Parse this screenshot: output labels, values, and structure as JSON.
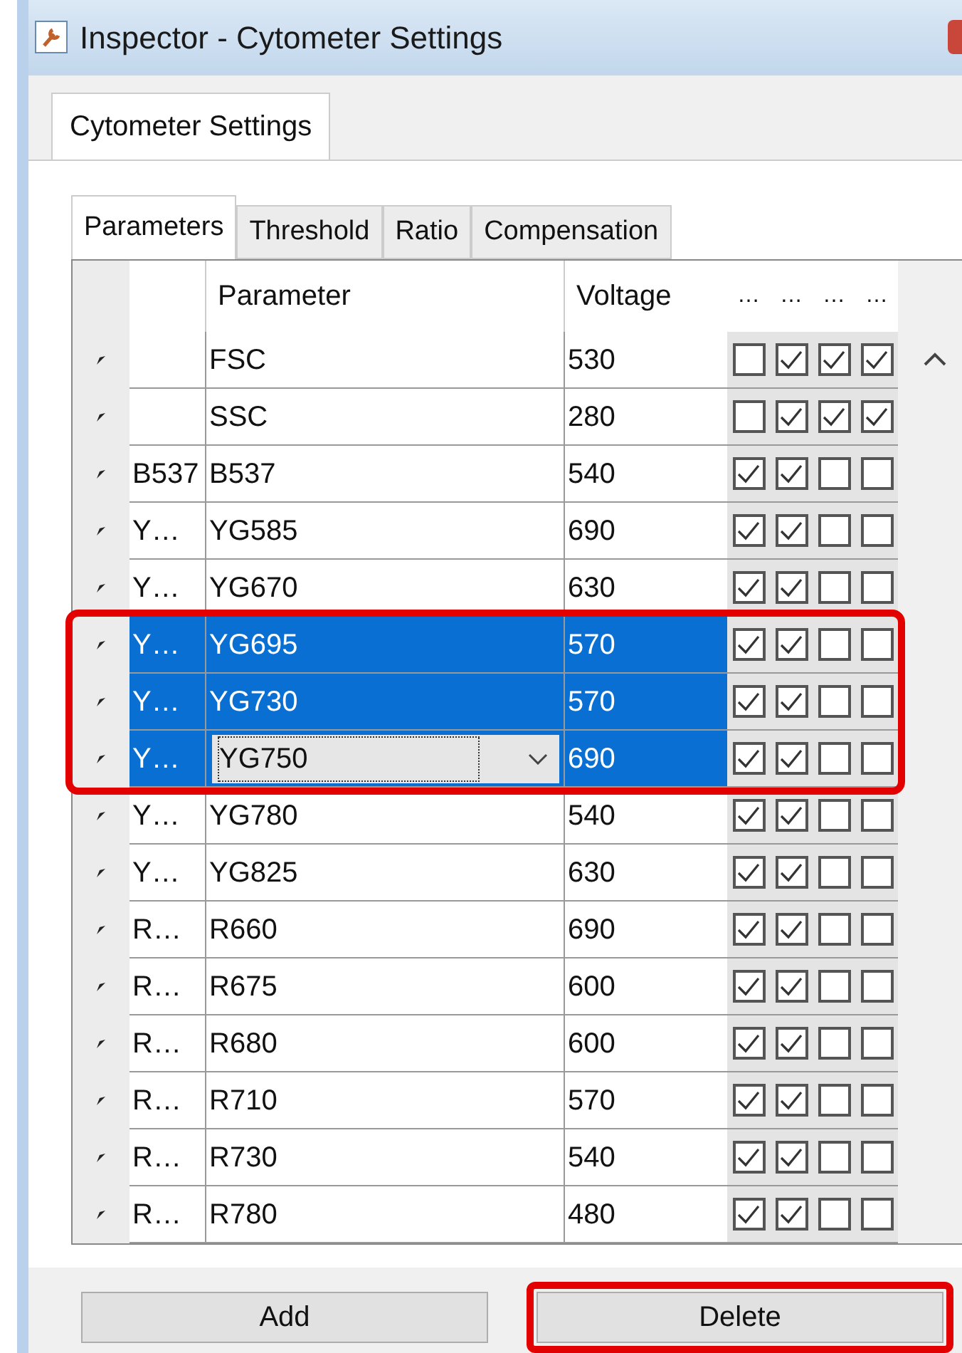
{
  "window": {
    "title": "Inspector - Cytometer Settings"
  },
  "outer_tabs": [
    {
      "label": "Cytometer Settings",
      "selected": true
    }
  ],
  "tabs": [
    {
      "label": "Parameters",
      "selected": true
    },
    {
      "label": "Threshold",
      "selected": false
    },
    {
      "label": "Ratio",
      "selected": false
    },
    {
      "label": "Compensation",
      "selected": false
    }
  ],
  "table": {
    "columns": [
      "Parameter",
      "Voltage"
    ],
    "check_columns": [
      "…",
      "…",
      "…",
      "…"
    ],
    "rows": [
      {
        "short": "",
        "parameter": "FSC",
        "voltage": "530",
        "selected": false,
        "editing": false,
        "highlight": false,
        "checks": [
          false,
          true,
          true,
          true
        ]
      },
      {
        "short": "",
        "parameter": "SSC",
        "voltage": "280",
        "selected": false,
        "editing": false,
        "highlight": false,
        "checks": [
          false,
          true,
          true,
          true
        ]
      },
      {
        "short": "B537",
        "parameter": "B537",
        "voltage": "540",
        "selected": false,
        "editing": false,
        "highlight": false,
        "checks": [
          true,
          true,
          false,
          false
        ]
      },
      {
        "short": "Y…",
        "parameter": "YG585",
        "voltage": "690",
        "selected": false,
        "editing": false,
        "highlight": false,
        "checks": [
          true,
          true,
          false,
          false
        ]
      },
      {
        "short": "Y…",
        "parameter": "YG670",
        "voltage": "630",
        "selected": false,
        "editing": false,
        "highlight": false,
        "checks": [
          true,
          true,
          false,
          false
        ]
      },
      {
        "short": "Y…",
        "parameter": "YG695",
        "voltage": "570",
        "selected": true,
        "editing": false,
        "highlight": true,
        "checks": [
          true,
          true,
          false,
          false
        ]
      },
      {
        "short": "Y…",
        "parameter": "YG730",
        "voltage": "570",
        "selected": true,
        "editing": false,
        "highlight": true,
        "checks": [
          true,
          true,
          false,
          false
        ]
      },
      {
        "short": "Y…",
        "parameter": "YG750",
        "voltage": "690",
        "selected": true,
        "editing": true,
        "highlight": true,
        "checks": [
          true,
          true,
          false,
          false
        ]
      },
      {
        "short": "Y…",
        "parameter": "YG780",
        "voltage": "540",
        "selected": false,
        "editing": false,
        "highlight": false,
        "checks": [
          true,
          true,
          false,
          false
        ]
      },
      {
        "short": "Y…",
        "parameter": "YG825",
        "voltage": "630",
        "selected": false,
        "editing": false,
        "highlight": false,
        "checks": [
          true,
          true,
          false,
          false
        ]
      },
      {
        "short": "R…",
        "parameter": "R660",
        "voltage": "690",
        "selected": false,
        "editing": false,
        "highlight": false,
        "checks": [
          true,
          true,
          false,
          false
        ]
      },
      {
        "short": "R…",
        "parameter": "R675",
        "voltage": "600",
        "selected": false,
        "editing": false,
        "highlight": false,
        "checks": [
          true,
          true,
          false,
          false
        ]
      },
      {
        "short": "R…",
        "parameter": "R680",
        "voltage": "600",
        "selected": false,
        "editing": false,
        "highlight": false,
        "checks": [
          true,
          true,
          false,
          false
        ]
      },
      {
        "short": "R…",
        "parameter": "R710",
        "voltage": "570",
        "selected": false,
        "editing": false,
        "highlight": false,
        "checks": [
          true,
          true,
          false,
          false
        ]
      },
      {
        "short": "R…",
        "parameter": "R730",
        "voltage": "540",
        "selected": false,
        "editing": false,
        "highlight": false,
        "checks": [
          true,
          true,
          false,
          false
        ]
      },
      {
        "short": "R…",
        "parameter": "R780",
        "voltage": "480",
        "selected": false,
        "editing": false,
        "highlight": false,
        "checks": [
          true,
          true,
          false,
          false
        ]
      }
    ]
  },
  "buttons": [
    {
      "label": "Add",
      "highlight": false
    },
    {
      "label": "Delete",
      "highlight": true
    }
  ]
}
